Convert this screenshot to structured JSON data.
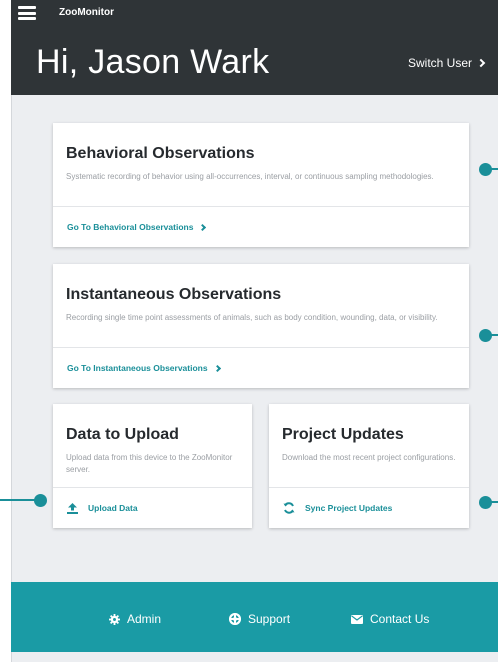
{
  "header": {
    "app_name": "ZooMonitor",
    "greeting": "Hi, Jason Wark",
    "switch_user": "Switch User"
  },
  "cards": {
    "behavioral": {
      "title": "Behavioral Observations",
      "description": "Systematic recording of behavior using all-occurrences, interval, or continuous sampling methodologies.",
      "link": "Go To Behavioral Observations"
    },
    "instantaneous": {
      "title": "Instantaneous Observations",
      "description": "Recording single time point assessments of animals, such as body condition, wounding, data, or visibility.",
      "link": "Go To Instantaneous Observations"
    },
    "upload": {
      "title": "Data to Upload",
      "description": "Upload data from this device to the ZooMonitor server.",
      "link": "Upload Data"
    },
    "updates": {
      "title": "Project Updates",
      "description": "Download the most recent project configurations.",
      "link": "Sync Project Updates"
    }
  },
  "footer": {
    "admin": "Admin",
    "support": "Support",
    "contact": "Contact Us"
  },
  "colors": {
    "accent": "#1a8f99",
    "footer_bg": "#1a9ba5",
    "header_bg": "#2f3437",
    "page_bg": "#eceef1"
  },
  "icons": [
    "menu-icon",
    "chevron-right-icon",
    "upload-icon",
    "sync-icon",
    "gear-icon",
    "lifebuoy-icon",
    "envelope-icon"
  ]
}
